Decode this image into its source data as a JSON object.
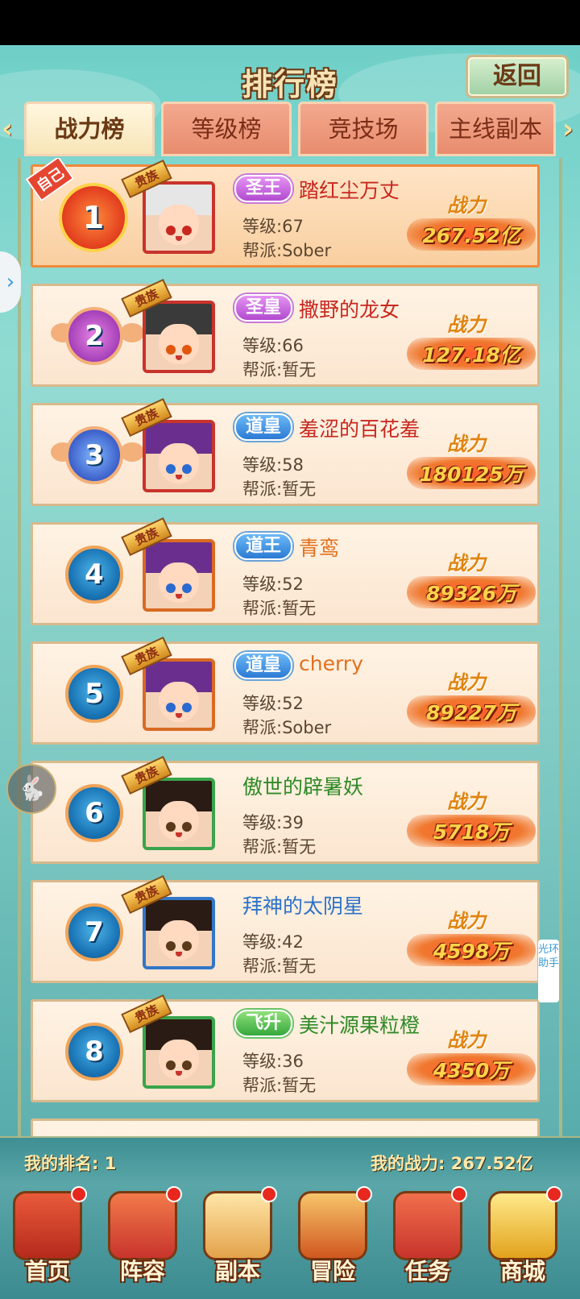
{
  "header": {
    "title": "排行榜",
    "back_label": "返回"
  },
  "tabs": [
    {
      "label": "战力榜",
      "active": true
    },
    {
      "label": "等级榜",
      "active": false
    },
    {
      "label": "竞技场",
      "active": false
    },
    {
      "label": "主线副本",
      "active": false
    }
  ],
  "tab_nav": {
    "prev": "‹",
    "next": "›"
  },
  "labels": {
    "power": "战力",
    "level_prefix": "等级:",
    "guild_prefix": "帮派:",
    "self_tag": "自己",
    "vip_tag": "贵族"
  },
  "rows": [
    {
      "rank": "1",
      "title": "圣王",
      "name": "踏红尘万丈",
      "level": "67",
      "guild": "Sober",
      "power": "267.52亿"
    },
    {
      "rank": "2",
      "title": "圣皇",
      "name": "撒野的龙女",
      "level": "66",
      "guild": "暂无",
      "power": "127.18亿"
    },
    {
      "rank": "3",
      "title": "道皇",
      "name": "羞涩的百花羞",
      "level": "58",
      "guild": "暂无",
      "power": "180125万"
    },
    {
      "rank": "4",
      "title": "道王",
      "name": "青鸾",
      "level": "52",
      "guild": "暂无",
      "power": "89326万"
    },
    {
      "rank": "5",
      "title": "道皇",
      "name": "cherry",
      "level": "52",
      "guild": "Sober",
      "power": "89227万"
    },
    {
      "rank": "6",
      "title": "",
      "name": "傲世的辟暑妖",
      "level": "39",
      "guild": "暂无",
      "power": "5718万"
    },
    {
      "rank": "7",
      "title": "",
      "name": "拜神的太阴星",
      "level": "42",
      "guild": "暂无",
      "power": "4598万"
    },
    {
      "rank": "8",
      "title": "飞升",
      "name": "美汁源果粒橙",
      "level": "36",
      "guild": "暂无",
      "power": "4350万"
    }
  ],
  "footer": {
    "my_rank_label": "我的排名:",
    "my_rank": "1",
    "my_power_label": "我的战力:",
    "my_power": "267.52亿"
  },
  "side": {
    "helper_text": "光环助手"
  },
  "nav": [
    {
      "label": "首页"
    },
    {
      "label": "阵容"
    },
    {
      "label": "副本"
    },
    {
      "label": "冒险"
    },
    {
      "label": "任务"
    },
    {
      "label": "商城"
    }
  ],
  "colors": {
    "accent": "#e0840f",
    "power_value": "#ffd34a",
    "tab_active": "#fff7df",
    "tab_inactive": "#f3a98e"
  }
}
